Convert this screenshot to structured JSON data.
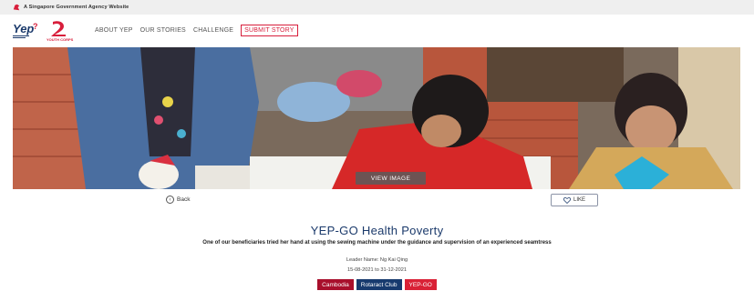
{
  "gov_banner": {
    "text": "A Singapore Government Agency Website"
  },
  "header": {
    "logo_yep": "Yep",
    "logo_yc_text": "YOUTH CORPS"
  },
  "nav": {
    "items": [
      "ABOUT YEP",
      "OUR STORIES",
      "CHALLENGE"
    ],
    "submit_label": "SUBMIT STORY"
  },
  "hero": {
    "view_image_label": "VIEW IMAGE"
  },
  "actions": {
    "back_label": "Back",
    "like_label": "LIKE"
  },
  "story": {
    "title": "YEP-GO Health Poverty",
    "description": "One of our beneficiaries tried her hand at using the sewing machine under the guidance and supervision of an experienced seamtress",
    "leader": "Leader Name: Ng Kai Qing",
    "dates": "15-08-2021 to 31-12-2021",
    "tags": [
      "Cambodia",
      "Rotaract Club",
      "YEP-GO"
    ]
  },
  "colors": {
    "brand_red": "#d81e3b",
    "brand_navy": "#1b3a6b",
    "tag_country": "#a80f2c",
    "tag_club": "#173a6e",
    "tag_program": "#d92136"
  }
}
